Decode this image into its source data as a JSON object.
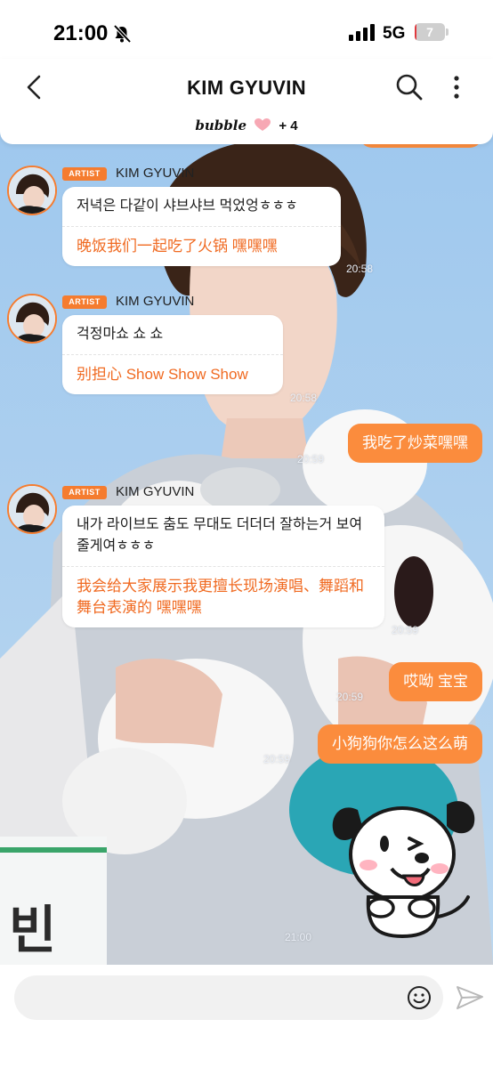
{
  "status_bar": {
    "time": "21:00",
    "network": "5G",
    "battery": "7",
    "battery_level_percent": 7
  },
  "header": {
    "title": "KIM GYUVIN",
    "back_icon": "chevron-left-icon",
    "search_icon": "search-icon",
    "more_icon": "more-vertical-icon",
    "brand": "bubble",
    "brand_extra": "+ 4",
    "heart_icon": "heart-icon"
  },
  "colors": {
    "accent": "#f57c2f",
    "my_bubble": "#fb8c3d",
    "translation_text": "#f06a21"
  },
  "messages": [
    {
      "badge": "ARTIST",
      "sender": "KIM GYUVIN",
      "text_ko": "저녁은 다같이 샤브샤브 먹었엉ㅎㅎㅎ",
      "text_zh": "晚饭我们一起吃了火锅 嘿嘿嘿",
      "time": "20:58"
    },
    {
      "badge": "ARTIST",
      "sender": "KIM GYUVIN",
      "text_ko": "걱정마쇼 쇼 쇼",
      "text_zh": "别担心 Show Show Show",
      "time": "20:58"
    },
    {
      "badge": "ARTIST",
      "sender": "KIM GYUVIN",
      "text_ko": "내가 라이브도 춤도 무대도 더더더 잘하는거 보여줄게여ㅎㅎㅎ",
      "text_zh": "我会给大家展示我更擅长现场演唱、舞蹈和舞台表演的 嘿嘿嘿",
      "time": "20:59"
    }
  ],
  "my_messages": [
    {
      "text": "我吃了炒菜嘿嘿",
      "time": "20:59"
    },
    {
      "text": "哎呦 宝宝",
      "time": "20:59"
    },
    {
      "text": "小狗狗你怎么这么萌",
      "time": "20:59"
    }
  ],
  "sticker": {
    "name": "puppy-sticker",
    "time": "21:00"
  },
  "input": {
    "placeholder": "",
    "emoji_icon": "smiley-icon",
    "send_icon": "send-icon"
  }
}
